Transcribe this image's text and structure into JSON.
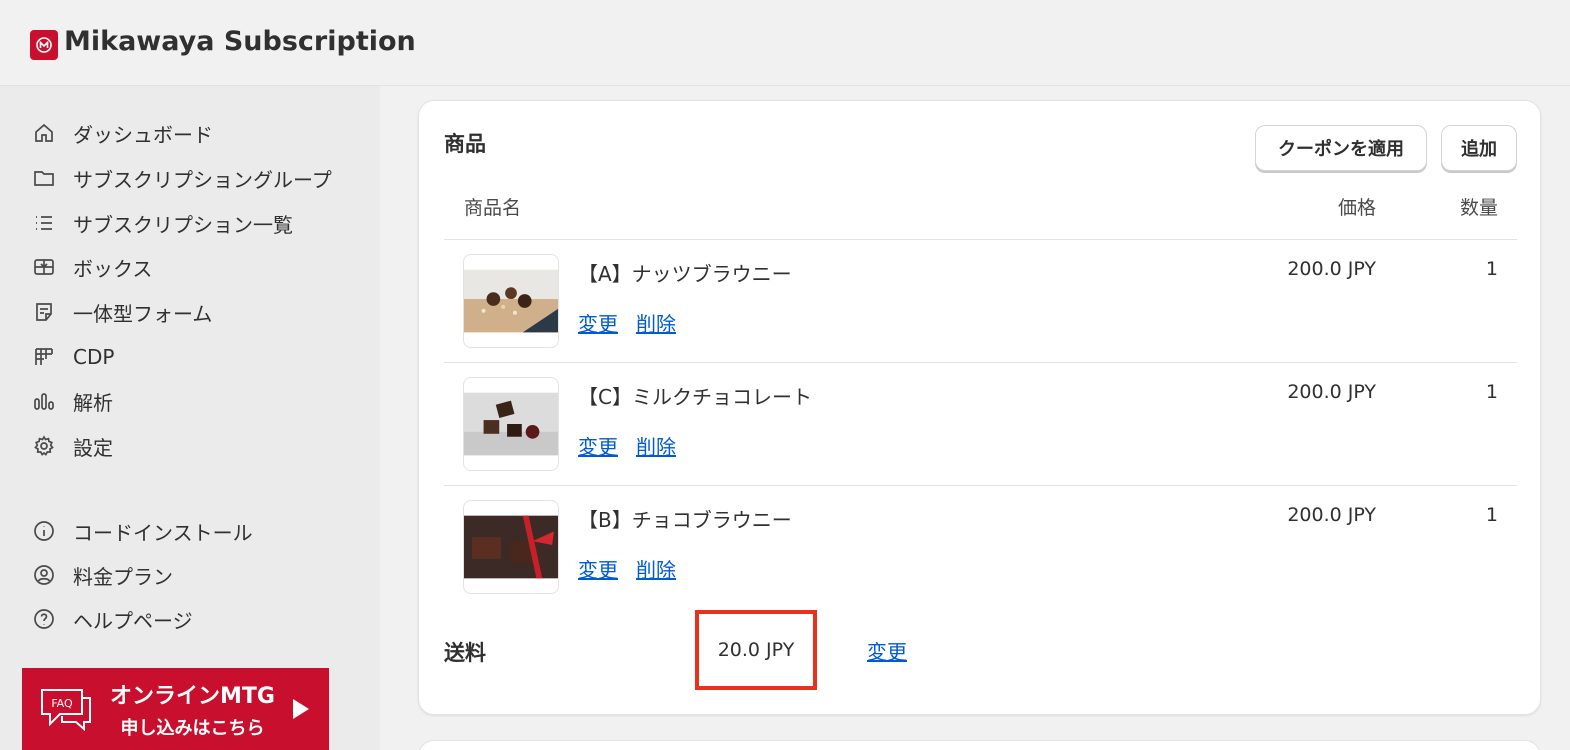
{
  "app": {
    "title": "Mikawaya Subscription"
  },
  "sidebar": {
    "items": [
      {
        "label": "ダッシュボード",
        "icon": "home-icon"
      },
      {
        "label": "サブスクリプショングループ",
        "icon": "folder-icon"
      },
      {
        "label": "サブスクリプション一覧",
        "icon": "list-icon"
      },
      {
        "label": "ボックス",
        "icon": "gift-box-icon"
      },
      {
        "label": "一体型フォーム",
        "icon": "form-icon"
      },
      {
        "label": "CDP",
        "icon": "grid-icon"
      },
      {
        "label": "解析",
        "icon": "bar-chart-icon"
      },
      {
        "label": "設定",
        "icon": "gear-icon"
      },
      {
        "label": "コードインストール",
        "icon": "info-icon"
      },
      {
        "label": "料金プラン",
        "icon": "user-circle-icon"
      },
      {
        "label": "ヘルプページ",
        "icon": "help-icon"
      }
    ],
    "promo": {
      "faq": "FAQ",
      "line1": "オンラインMTG",
      "line2": "申し込みはこちら",
      "color": "#c8102e"
    }
  },
  "products": {
    "title": "商品",
    "coupon_button": "クーポンを適用",
    "add_button": "追加",
    "columns": {
      "name": "商品名",
      "price": "価格",
      "qty": "数量"
    },
    "items": [
      {
        "name": "【A】ナッツブラウニー",
        "price": "200.0 JPY",
        "qty": "1",
        "change": "変更",
        "delete": "削除",
        "thumb": "nut-brownie-image"
      },
      {
        "name": "【C】ミルクチョコレート",
        "price": "200.0 JPY",
        "qty": "1",
        "change": "変更",
        "delete": "削除",
        "thumb": "milk-chocolate-image"
      },
      {
        "name": "【B】チョコブラウニー",
        "price": "200.0 JPY",
        "qty": "1",
        "change": "変更",
        "delete": "削除",
        "thumb": "choco-brownie-image"
      }
    ],
    "shipping": {
      "label": "送料",
      "value": "20.0 JPY",
      "change": "変更",
      "highlight_color": "#e8321e"
    }
  },
  "colors": {
    "link": "#005bd3",
    "accent": "#c8102e"
  }
}
